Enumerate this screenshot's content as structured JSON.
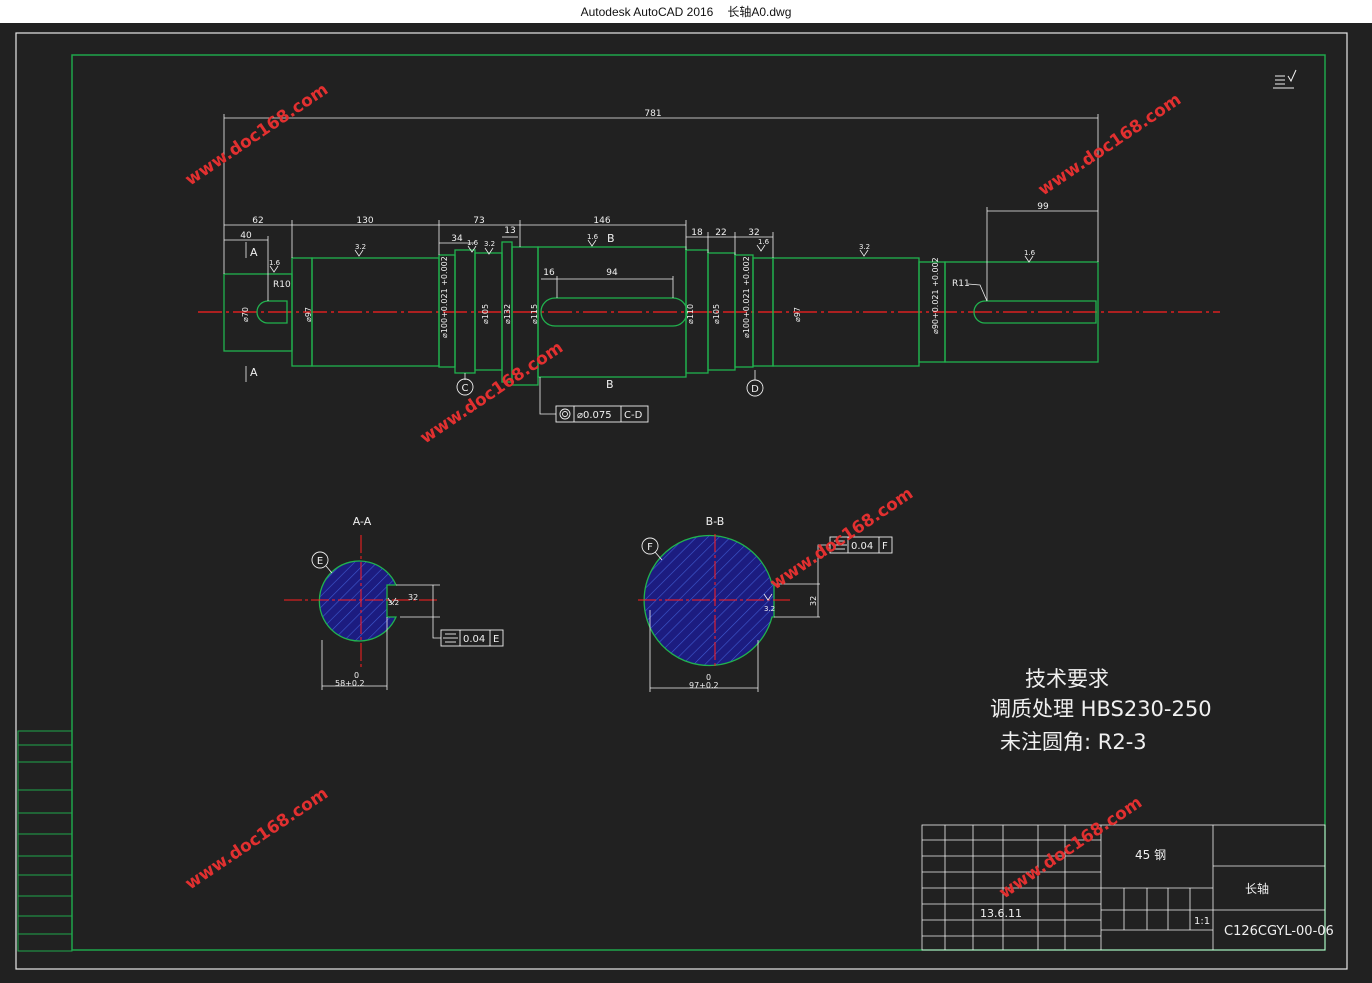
{
  "window": {
    "app_title": "Autodesk AutoCAD 2016",
    "file_name": "长轴A0.dwg"
  },
  "colors": {
    "background": "#212121",
    "border_white": "#e8e8e8",
    "frame_green": "#1fa64a",
    "outline_green": "#21b24e",
    "dimension_white": "#f0f0f0",
    "centerline_red": "#ff2020",
    "section_fill": "#1c1c80",
    "hatch": "#3f5ad0",
    "watermark_red": "#e23030"
  },
  "dimensions": {
    "overall": "781",
    "d62": "62",
    "d40": "40",
    "d130": "130",
    "d73": "73",
    "d34": "34",
    "d13": "13",
    "d146": "146",
    "d16": "16",
    "d94": "94",
    "d18": "18",
    "d22": "22",
    "d32": "32",
    "d99": "99",
    "d_phi70": "⌀70",
    "d_phi97a": "⌀97",
    "d_phi100a": "⌀100+0.021 +0.002",
    "d_phi105a": "⌀105",
    "d_phi132": "⌀132",
    "d_phi115": "⌀115",
    "d_phi110": "⌀110",
    "d_phi105b": "⌀105",
    "d_phi100b": "⌀100+0.021 +0.002",
    "d_phi97b": "⌀97",
    "d_phi90": "⌀90+0.021 +0.002",
    "r10": "R10",
    "r11": "R11",
    "rough16": "1.6",
    "rough32": "3.2"
  },
  "sections": {
    "label_a": "A",
    "label_b": "B",
    "title_aa": "A-A",
    "title_bb": "B-B",
    "datum_c": "C",
    "datum_d": "D",
    "datum_e": "E",
    "datum_f": "F",
    "tol_cd_value": "⌀0.075",
    "tol_cd_datum": "C-D",
    "tol_e_value": "0.04",
    "tol_e_datum": "E",
    "tol_f_value": "0.04",
    "tol_f_datum": "F",
    "aa_width": "58+0.2",
    "aa_width_upper": "0",
    "aa_key": "32",
    "bb_width": "97+0.2",
    "bb_width_upper": "0",
    "bb_key": "32"
  },
  "requirements": {
    "heading": "技术要求",
    "line1": "调质处理 HBS230-250",
    "line2": "未注圆角: R2-3"
  },
  "title_block": {
    "material": "45 钢",
    "part_name": "长轴",
    "drawing_number": "C126CGYL-00-06",
    "scale": "1:1",
    "date": "13.6.11"
  },
  "watermark": "www.doc168.com"
}
